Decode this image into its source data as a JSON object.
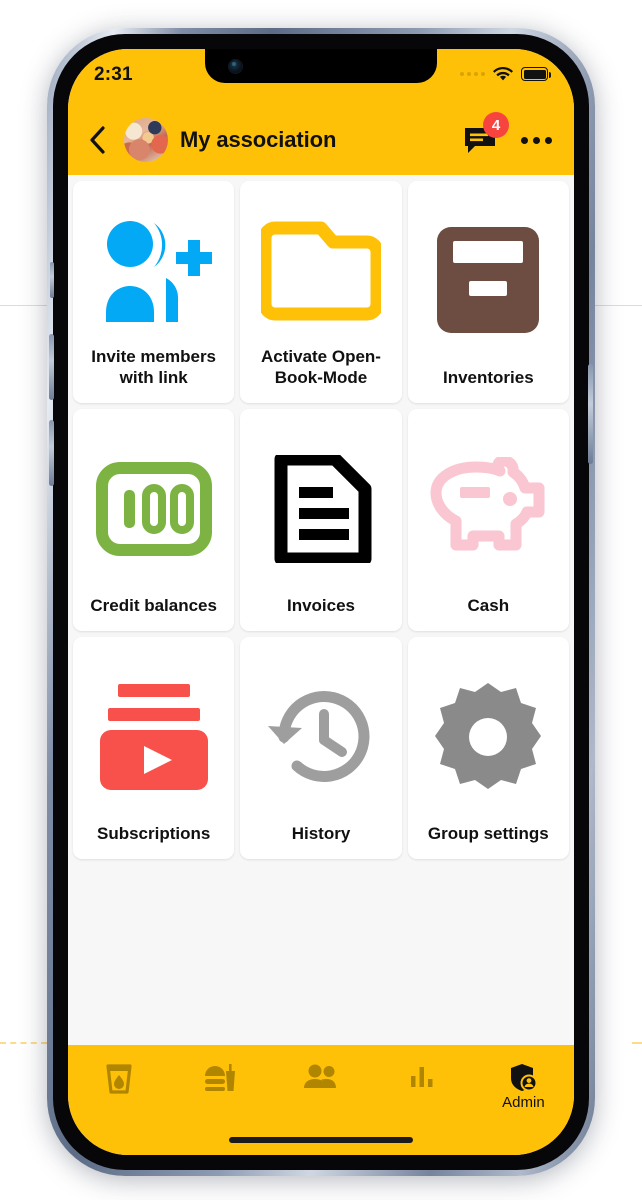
{
  "status_bar": {
    "time": "2:31",
    "signal_icon": "signal-dots-icon",
    "wifi_icon": "wifi-icon",
    "battery_icon": "battery-full-icon"
  },
  "app_bar": {
    "back_icon": "back-chevron-icon",
    "avatar_icon": "group-avatar-photo",
    "title": "My association",
    "chat_icon": "chat-bubble-icon",
    "chat_badge": "4",
    "more_icon": "more-options-icon"
  },
  "grid": {
    "tiles": [
      {
        "label": "Invite members with link",
        "icon": "person-add-icon",
        "color": "#03A9F4"
      },
      {
        "label": "Activate Open-Book-Mode",
        "icon": "folder-open-icon",
        "color": "#FFC107"
      },
      {
        "label": "Inventories",
        "icon": "archive-box-icon",
        "color": "#6D4C41"
      },
      {
        "label": "Credit balances",
        "icon": "banknote-100-icon",
        "color": "#7CB342"
      },
      {
        "label": "Invoices",
        "icon": "document-lines-icon",
        "color": "#000000"
      },
      {
        "label": "Cash",
        "icon": "piggy-bank-icon",
        "color": "#F9C6D1"
      },
      {
        "label": "Subscriptions",
        "icon": "subscriptions-play-icon",
        "color": "#F8504B"
      },
      {
        "label": "History",
        "icon": "history-clock-icon",
        "color": "#9E9E9E"
      },
      {
        "label": "Group settings",
        "icon": "gear-icon",
        "color": "#8A8A8A"
      }
    ]
  },
  "bottom_nav": {
    "items": [
      {
        "label": "",
        "icon": "drink-glass-icon"
      },
      {
        "label": "",
        "icon": "fast-food-icon"
      },
      {
        "label": "",
        "icon": "people-icon"
      },
      {
        "label": "",
        "icon": "bar-chart-icon"
      },
      {
        "label": "Admin",
        "icon": "admin-shield-icon"
      }
    ]
  },
  "theme": {
    "accent": "#FFC107",
    "badge": "#F8443F",
    "screen_bg": "#F7F7F7",
    "tile_bg": "#FFFFFF"
  }
}
